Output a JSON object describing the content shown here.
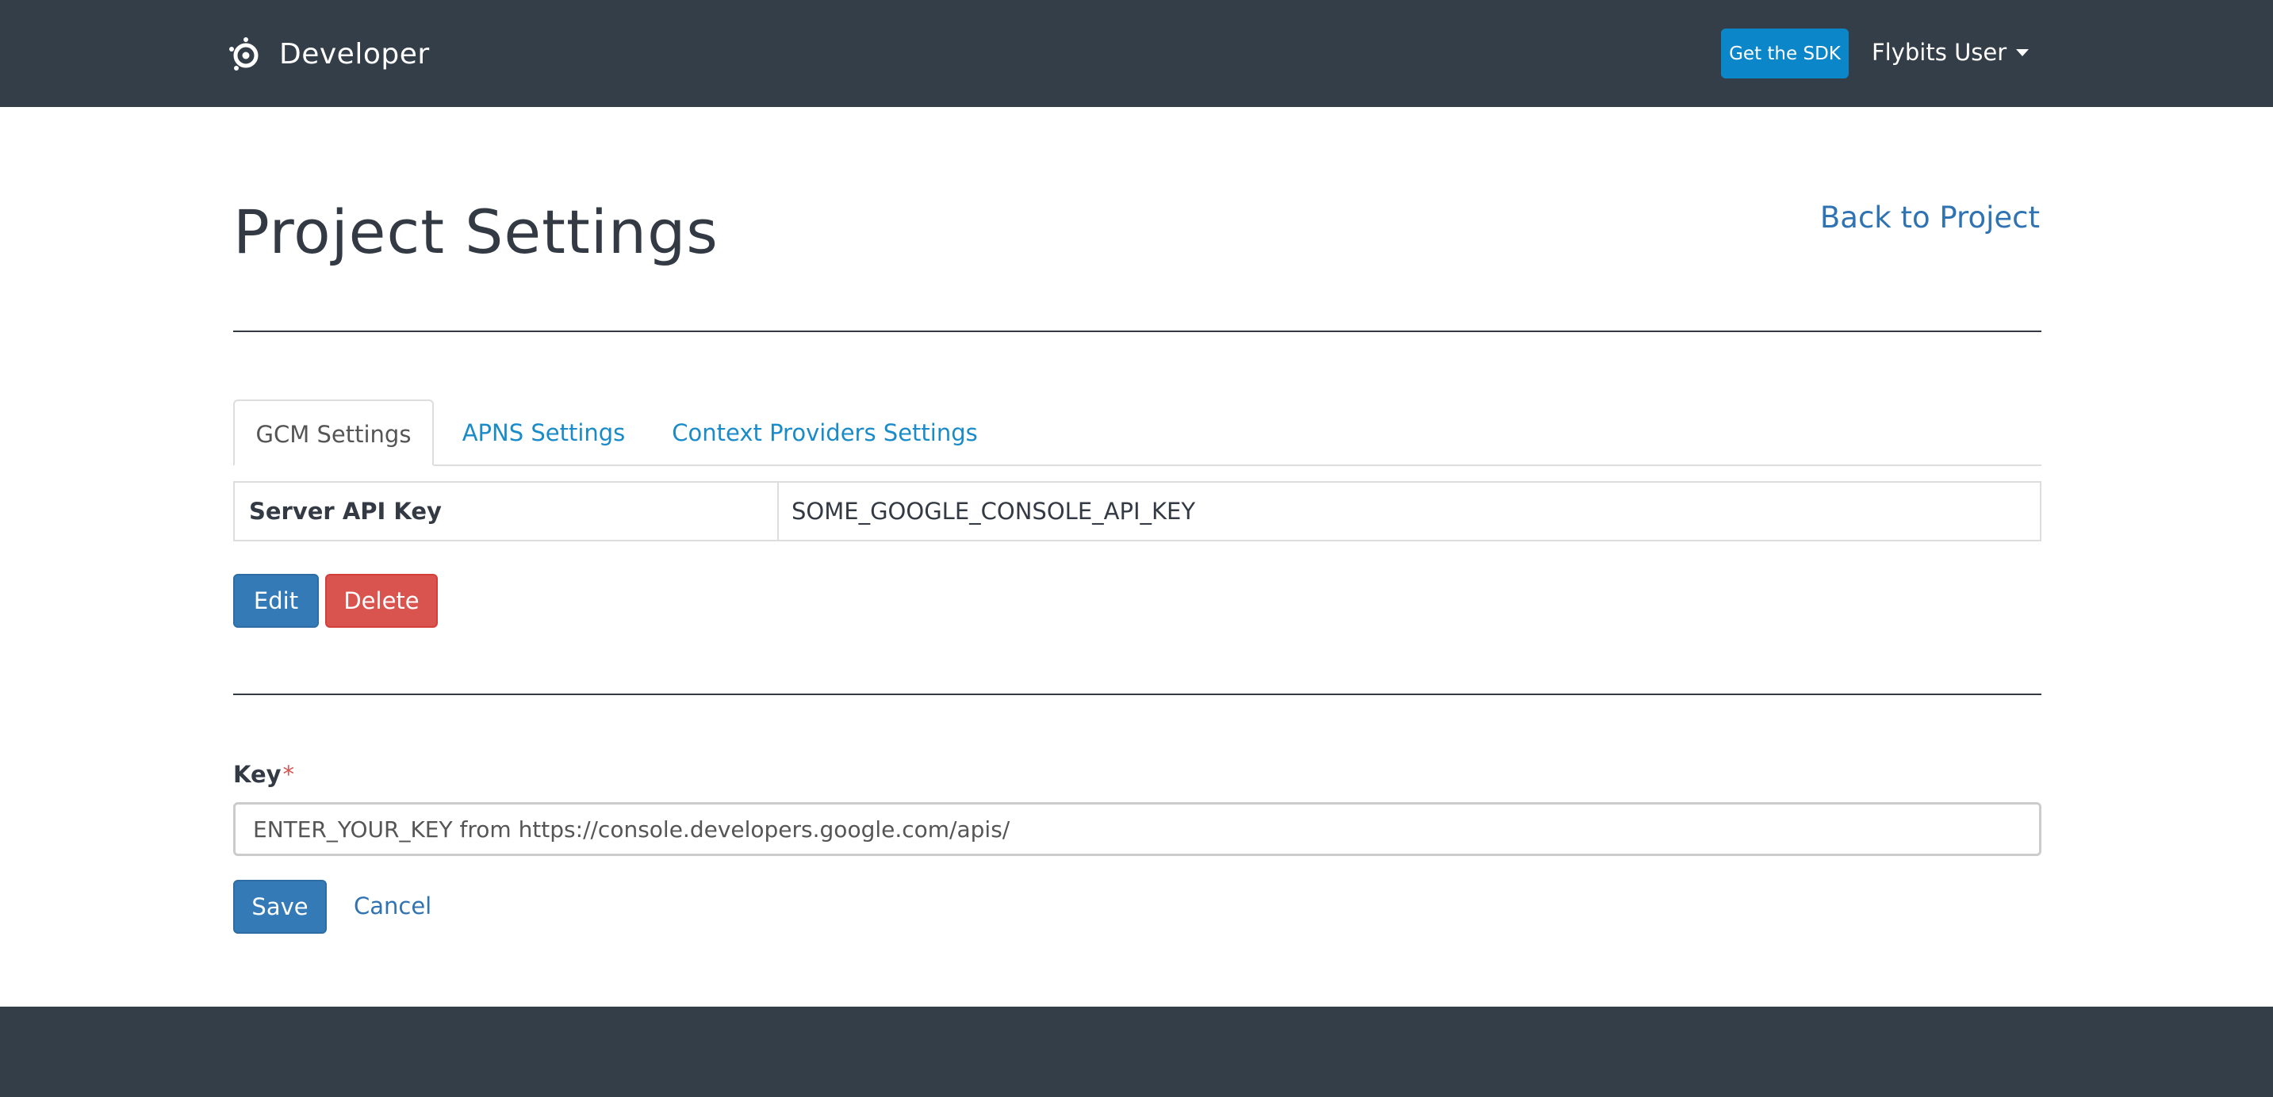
{
  "navbar": {
    "brand": "Developer",
    "sdk_button": "Get the SDK",
    "user_menu": "Flybits User"
  },
  "page": {
    "title": "Project Settings",
    "back_link": "Back to Project"
  },
  "tabs": [
    {
      "label": "GCM Settings",
      "active": true
    },
    {
      "label": "APNS Settings",
      "active": false
    },
    {
      "label": "Context Providers Settings",
      "active": false
    }
  ],
  "settings_table": {
    "key": "Server API Key",
    "value": "SOME_GOOGLE_CONSOLE_API_KEY"
  },
  "actions": {
    "edit": "Edit",
    "delete": "Delete"
  },
  "form": {
    "label": "Key",
    "required_mark": "*",
    "value": "ENTER_YOUR_KEY from https://console.developers.google.com/apis/",
    "save": "Save",
    "cancel": "Cancel"
  },
  "colors": {
    "navbar": "#343e48",
    "sdk_button": "#0b86c9",
    "primary": "#337ab7",
    "danger": "#d9534f",
    "link": "#2f73b3"
  },
  "icons": {
    "brand": "flybits-logo-icon",
    "user_menu": "caret-down-icon"
  }
}
